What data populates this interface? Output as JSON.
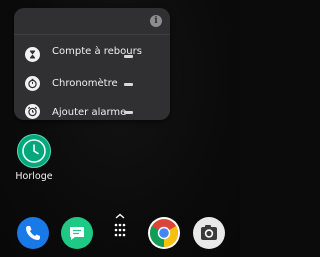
{
  "popup": {
    "info_icon_glyph": "i",
    "shortcuts": [
      {
        "label": "Compte à rebours",
        "icon": "hourglass-icon"
      },
      {
        "label": "Chronomètre",
        "icon": "stopwatch-icon"
      },
      {
        "label": "Ajouter alarme",
        "icon": "alarm-clock-icon"
      }
    ]
  },
  "app": {
    "label": "Horloge",
    "icon": "clock-icon",
    "color": "#00a87c"
  },
  "dock": {
    "apps": [
      {
        "name": "phone",
        "icon": "phone-icon",
        "color": "#1979e6"
      },
      {
        "name": "messages",
        "icon": "messages-icon",
        "color": "#1ec985"
      },
      {
        "name": "app-drawer",
        "icon": "app-drawer-icon"
      },
      {
        "name": "chrome",
        "icon": "chrome-icon"
      },
      {
        "name": "camera",
        "icon": "camera-icon"
      }
    ]
  },
  "colors": {
    "popup_background": "#303033",
    "wallpaper": "#0b0b0c"
  }
}
